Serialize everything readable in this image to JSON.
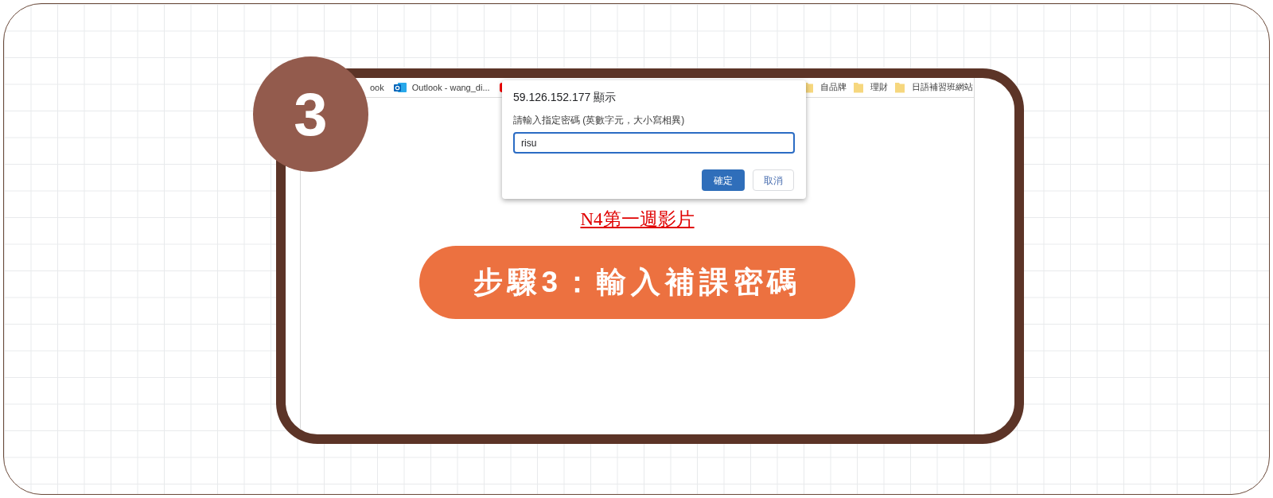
{
  "step_badge": "3",
  "bookmarks": [
    {
      "kind": "plain",
      "label": "ook"
    },
    {
      "kind": "outlook",
      "label": "Outlook - wang_di..."
    },
    {
      "kind": "youtube"
    },
    {
      "kind": "folder",
      "label": "自品牌"
    },
    {
      "kind": "folder",
      "label": "理財"
    },
    {
      "kind": "folder",
      "label": "日語補習班網站"
    }
  ],
  "dialog": {
    "title": "59.126.152.177 顯示",
    "message": "請輸入指定密碼 (英數字元，大小寫相異)",
    "input_value": "risu",
    "buttons": [
      {
        "label": "確定",
        "kind": "primary"
      },
      {
        "label": "取消",
        "kind": "secondary"
      }
    ]
  },
  "page_link": "N4第一週影片",
  "step_banner": "步驟3：輸入補課密碼"
}
